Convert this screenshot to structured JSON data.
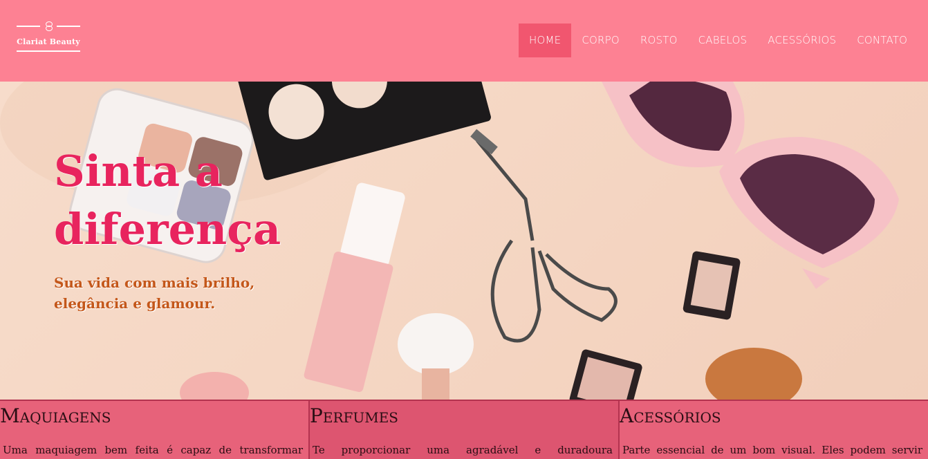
{
  "header": {
    "logo_text": "Clariat Beauty",
    "nav": [
      {
        "label": "HOME",
        "active": true
      },
      {
        "label": "CORPO",
        "active": false
      },
      {
        "label": "ROSTO",
        "active": false
      },
      {
        "label": "CABELOS",
        "active": false
      },
      {
        "label": "ACESSÓRIOS",
        "active": false
      },
      {
        "label": "CONTATO",
        "active": false
      }
    ]
  },
  "hero": {
    "title_line1": "Sinta a",
    "title_line2": "diferença",
    "subtitle_line1": "Sua vida com mais brilho,",
    "subtitle_line2": "elegância e glamour."
  },
  "cards": [
    {
      "title": "Maquiagens",
      "text": "Uma maquiagem bem feita é capaz de transformar"
    },
    {
      "title": "Perfumes",
      "text": "Te proporcionar uma agradável e duradoura"
    },
    {
      "title": "Acessórios",
      "text": "Parte essencial de um bom visual. Eles podem servir"
    }
  ],
  "colors": {
    "header_bg": "#fd8193",
    "nav_active_bg": "#f1566f",
    "hero_title": "#e8245e",
    "hero_subtitle": "#c4571a",
    "card_bg": "#e7627a"
  }
}
